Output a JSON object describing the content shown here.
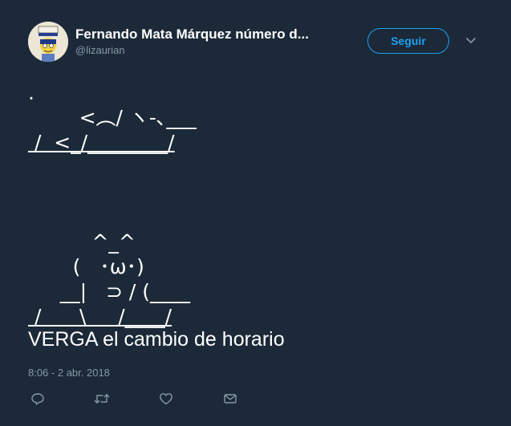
{
  "author": {
    "display_name": "Fernando Mata Márquez número d...",
    "handle": "@lizaurian",
    "avatar_icon": "avatar-image"
  },
  "follow_button": {
    "label": "Seguir"
  },
  "tweet": {
    "ascii_lines": [
      ".",
      "        <︵/ ヽ-､___",
      " /  <_/________/",
      "",
      "",
      "",
      "          ^_^",
      "       (   ･ω･)",
      "     __|   ⊃ / (____",
      " /      \\     /____/"
    ],
    "text": "VERGA el cambio de horario",
    "timestamp": "8:06 - 2 abr. 2018"
  },
  "actions": {
    "reply_icon": "reply-icon",
    "retweet_icon": "retweet-icon",
    "like_icon": "heart-icon",
    "dm_icon": "envelope-icon"
  },
  "colors": {
    "background": "#1c2938",
    "accent": "#1da1f2",
    "secondary_text": "#8899a6",
    "text": "#ffffff"
  }
}
